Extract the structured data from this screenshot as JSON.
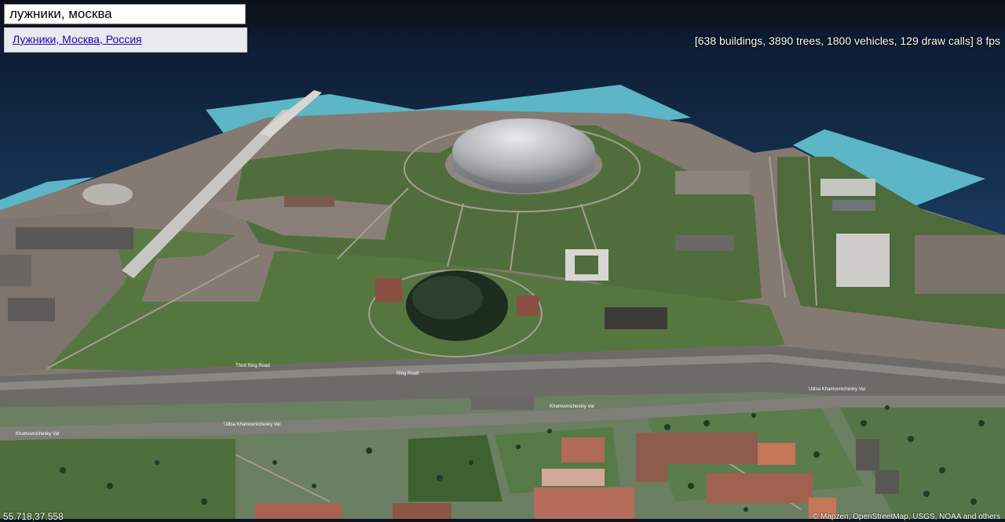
{
  "search": {
    "value": "лужники, москва"
  },
  "suggestions": [
    {
      "label": "Лужники, Москва, Россия"
    }
  ],
  "stats": "[638 buildings, 3890 trees, 1800 vehicles, 129 draw calls] 8 fps",
  "coordinates": "55.718,37.558",
  "attribution": "© Mapzen, OpenStreetMap, USGS, NOAA and others",
  "road_labels": {
    "third_ring": "Third Ring Road",
    "ring_road": "Ring Road",
    "khamovnichesky": "Khamovnichesky Val",
    "ulitsa": "Ulitsa Khamovnichesky Val",
    "khamovnicheskiy": "Khamovnicheskiy Val",
    "ulitsa2": "Ulitsa Khamovnichesky Val"
  },
  "colors": {
    "river": "#0e2746",
    "embankment": "#5cb6c6",
    "grass": "#4f6d3c",
    "ground": "#857a72",
    "dome": "#b6b8bc"
  }
}
